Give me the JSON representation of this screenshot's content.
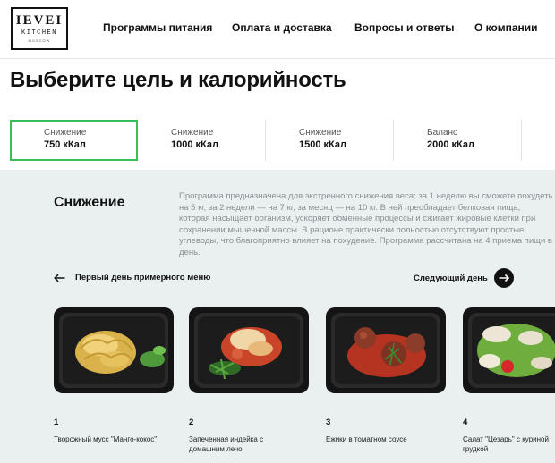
{
  "logo": {
    "top": "IEVEI",
    "middle": "KITCHEN",
    "bottom": "MOSCOW"
  },
  "nav": {
    "items": [
      "Программы питания",
      "Оплата и доставка",
      "Вопросы и ответы",
      "О компании"
    ]
  },
  "page_title": "Выберите цель и калорийность",
  "tabs": [
    {
      "caption": "Снижение",
      "value": "750 кКал",
      "active": true
    },
    {
      "caption": "Снижение",
      "value": "1000 кКал",
      "active": false
    },
    {
      "caption": "Снижение",
      "value": "1500 кКал",
      "active": false
    },
    {
      "caption": "Баланс",
      "value": "2000 кКал",
      "active": false
    }
  ],
  "program": {
    "title": "Снижение",
    "description": "Программа предназначена для экстренного снижения веса: за 1 неделю вы сможете похудеть на 5 кг, за 2 недели — на 7 кг, за месяц — на 10 кг. В ней преобладает белковая пища, которая насыщает организм, ускоряет обменные процессы и сжигает жировые клетки при сохранении мышечной массы. В рационе практически полностью отсутствуют простые углеводы, что благоприятно влияет на похудение. Программа рассчитана на 4 приема пищи в день."
  },
  "menu_nav": {
    "prev_label": "Первый день примерного меню",
    "next_label": "Следующий день"
  },
  "dishes": [
    {
      "number": "1",
      "name": "Творожный мусс \"Манго-кокос\""
    },
    {
      "number": "2",
      "name": "Запеченная индейка с домашним лечо"
    },
    {
      "number": "3",
      "name": "Ежики в томатном соусе"
    },
    {
      "number": "4",
      "name": "Салат \"Цезарь\" с куриной грудкой"
    }
  ],
  "colors": {
    "accent": "#3bbf5a",
    "panel_bg": "#eaf0f0",
    "text": "#111111",
    "muted": "#8a8f94"
  }
}
